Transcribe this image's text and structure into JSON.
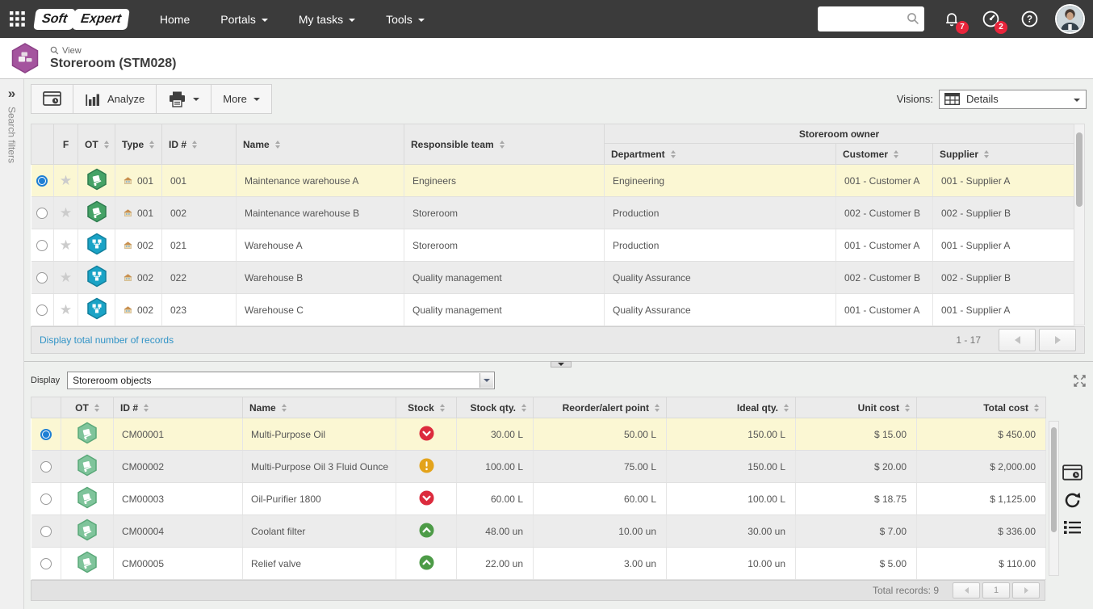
{
  "topbar": {
    "logo_soft": "Soft",
    "logo_expert": "Expert",
    "nav": [
      {
        "label": "Home",
        "dropdown": false
      },
      {
        "label": "Portals",
        "dropdown": true
      },
      {
        "label": "My tasks",
        "dropdown": true
      },
      {
        "label": "Tools",
        "dropdown": true
      }
    ],
    "search": {
      "value": "",
      "placeholder": ""
    },
    "notifications_badge": "7",
    "alerts_badge": "2"
  },
  "page_header": {
    "view_label": "View",
    "title": "Storeroom (STM028)"
  },
  "filters_panel": {
    "label": "Search filters",
    "expand_glyph": "»"
  },
  "toolbar": {
    "analyze_label": "Analyze",
    "more_label": "More",
    "visions_label": "Visions:",
    "visions_value": "Details"
  },
  "storerooms_table": {
    "group_header": "Storeroom owner",
    "columns": {
      "f": "F",
      "ot": "OT",
      "type": "Type",
      "id": "ID #",
      "name": "Name",
      "team": "Responsible team",
      "department": "Department",
      "customer": "Customer",
      "supplier": "Supplier"
    },
    "rows": [
      {
        "selected": true,
        "ot_icon": "storeroom-hex-green",
        "type": "001",
        "id": "001",
        "name": "Maintenance warehouse A",
        "team": "Engineers",
        "department": "Engineering",
        "customer": "001 - Customer A",
        "supplier": "001 - Supplier A"
      },
      {
        "selected": false,
        "ot_icon": "storeroom-hex-green",
        "type": "001",
        "id": "002",
        "name": "Maintenance warehouse B",
        "team": "Storeroom",
        "department": "Production",
        "customer": "002 - Customer B",
        "supplier": "002 - Supplier B"
      },
      {
        "selected": false,
        "ot_icon": "warehouse-hex-blue",
        "type": "002",
        "id": "021",
        "name": "Warehouse A",
        "team": "Storeroom",
        "department": "Production",
        "customer": "001 - Customer A",
        "supplier": "001 - Supplier A"
      },
      {
        "selected": false,
        "ot_icon": "warehouse-hex-blue",
        "type": "002",
        "id": "022",
        "name": "Warehouse B",
        "team": "Quality management",
        "department": "Quality Assurance",
        "customer": "002 - Customer B",
        "supplier": "002 - Supplier B"
      },
      {
        "selected": false,
        "ot_icon": "warehouse-hex-blue",
        "type": "002",
        "id": "023",
        "name": "Warehouse C",
        "team": "Quality management",
        "department": "Quality Assurance",
        "customer": "001 - Customer A",
        "supplier": "001 - Supplier A"
      }
    ],
    "footer": {
      "records_link": "Display total number of records",
      "range": "1 - 17"
    }
  },
  "display_bar": {
    "label": "Display",
    "selected_option": "Storeroom objects"
  },
  "objects_table": {
    "columns": {
      "ot": "OT",
      "id": "ID #",
      "name": "Name",
      "stock": "Stock",
      "stock_qty": "Stock qty.",
      "reorder": "Reorder/alert point",
      "ideal": "Ideal qty.",
      "unit_cost": "Unit cost",
      "total_cost": "Total cost"
    },
    "rows": [
      {
        "selected": true,
        "id": "CM00001",
        "name": "Multi-Purpose Oil",
        "stock_status": "low",
        "stock_qty": "30.00 L",
        "reorder": "50.00 L",
        "ideal": "150.00 L",
        "unit_cost": "$ 15.00",
        "total_cost": "$ 450.00"
      },
      {
        "selected": false,
        "id": "CM00002",
        "name": "Multi-Purpose Oil 3 Fluid Ounce",
        "stock_status": "warning",
        "stock_qty": "100.00 L",
        "reorder": "75.00 L",
        "ideal": "150.00 L",
        "unit_cost": "$ 20.00",
        "total_cost": "$ 2,000.00"
      },
      {
        "selected": false,
        "id": "CM00003",
        "name": "Oil-Purifier 1800",
        "stock_status": "low",
        "stock_qty": "60.00 L",
        "reorder": "60.00 L",
        "ideal": "100.00 L",
        "unit_cost": "$ 18.75",
        "total_cost": "$ 1,125.00"
      },
      {
        "selected": false,
        "id": "CM00004",
        "name": "Coolant filter",
        "stock_status": "ok",
        "stock_qty": "48.00 un",
        "reorder": "10.00 un",
        "ideal": "30.00 un",
        "unit_cost": "$ 7.00",
        "total_cost": "$ 336.00"
      },
      {
        "selected": false,
        "id": "CM00005",
        "name": "Relief valve",
        "stock_status": "ok",
        "stock_qty": "22.00 un",
        "reorder": "3.00 un",
        "ideal": "10.00 un",
        "unit_cost": "$ 5.00",
        "total_cost": "$ 110.00"
      }
    ],
    "footer": {
      "total_label": "Total records: 9",
      "page": "1"
    }
  },
  "icons": {
    "app-grid-icon": "3x3-dot-grid",
    "search-icon": "magnifier",
    "notifications-icon": "bell",
    "pending-tasks-icon": "gauge",
    "help-icon": "question-circle",
    "module-icon": "purple-hexagon-boxes",
    "view-screen-icon": "window-with-clock",
    "analyze-icon": "bar-chart",
    "print-icon": "printer",
    "visions-icon": "table-grid",
    "storeroom-hex-green": "green-hexagon-handtruck",
    "warehouse-hex-blue": "blue-hexagon-structure",
    "type-icon": "warehouse-house",
    "stock-low-icon": "red-circle-chevron-down",
    "stock-warning-icon": "amber-circle-exclamation",
    "stock-ok-icon": "green-circle-chevron-up",
    "refresh-icon": "circular-arrow",
    "list-icon": "bulleted-list",
    "fullscreen-icon": "four-corner-arrows"
  },
  "colors": {
    "topbar_bg": "#3b3b3b",
    "badge_red": "#e8253b",
    "selected_row_bg": "#fbf7d3",
    "alt_row_bg": "#ececec",
    "link_blue": "#3193c6",
    "radio_selected": "#1f7fd4",
    "stock_low": "#dc2b3d",
    "stock_warning": "#e3a31b",
    "stock_ok": "#4d9b47",
    "hex_green": "#45a266",
    "hex_green_light": "#7fc49b",
    "hex_blue": "#1aa3c6",
    "module_hex_purple": "#a4549e"
  }
}
